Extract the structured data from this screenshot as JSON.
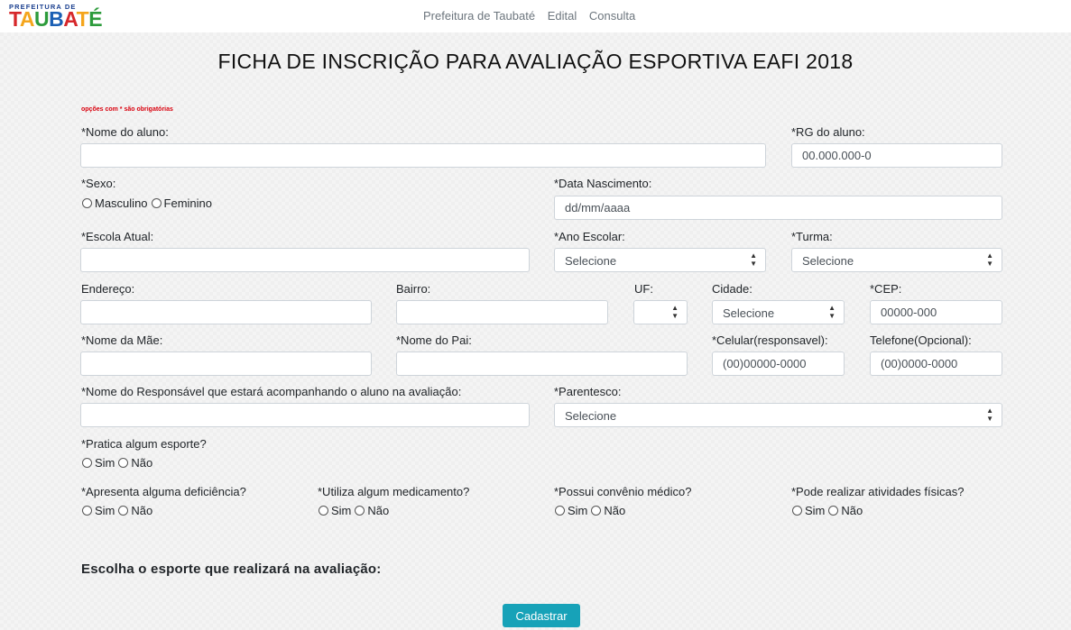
{
  "header": {
    "logo_top": "PREFEITURA DE",
    "logo_letters": [
      "T",
      "A",
      "U",
      "B",
      "A",
      "T",
      "É"
    ],
    "nav": [
      "Prefeitura de Taubaté",
      "Edital",
      "Consulta"
    ]
  },
  "form": {
    "title": "FICHA DE INSCRIÇÃO PARA AVALIAÇÃO ESPORTIVA EAFI 2018",
    "required_note": "opções com * são obrigatórias",
    "nome_aluno": {
      "label": "*Nome do aluno:",
      "placeholder": ""
    },
    "rg_aluno": {
      "label": "*RG do aluno:",
      "placeholder": "00.000.000-0"
    },
    "sexo": {
      "label": "*Sexo:",
      "options": [
        "Masculino",
        "Feminino"
      ]
    },
    "data_nascimento": {
      "label": "*Data Nascimento:",
      "placeholder": "dd/mm/aaaa"
    },
    "escola": {
      "label": "*Escola Atual:",
      "placeholder": ""
    },
    "ano_escolar": {
      "label": "*Ano Escolar:",
      "value": "Selecione"
    },
    "turma": {
      "label": "*Turma:",
      "value": "Selecione"
    },
    "endereco": {
      "label": "Endereço:",
      "placeholder": ""
    },
    "bairro": {
      "label": "Bairro:",
      "placeholder": ""
    },
    "uf": {
      "label": "UF:",
      "value": ""
    },
    "cidade": {
      "label": "Cidade:",
      "value": "Selecione"
    },
    "cep": {
      "label": "*CEP:",
      "placeholder": "00000-000"
    },
    "nome_mae": {
      "label": "*Nome da Mãe:",
      "placeholder": ""
    },
    "nome_pai": {
      "label": "*Nome do Pai:",
      "placeholder": ""
    },
    "celular": {
      "label": "*Celular(responsavel):",
      "placeholder": "(00)00000-0000"
    },
    "telefone": {
      "label": "Telefone(Opcional):",
      "placeholder": "(00)0000-0000"
    },
    "responsavel": {
      "label": "*Nome do Responsável que estará acompanhando o aluno na avaliação:",
      "placeholder": ""
    },
    "parentesco": {
      "label": "*Parentesco:",
      "value": "Selecione"
    },
    "pratica_esporte": {
      "label": "*Pratica algum esporte?",
      "options": [
        "Sim",
        "Não"
      ]
    },
    "deficiencia": {
      "label": "*Apresenta alguma deficiência?",
      "options": [
        "Sim",
        "Não"
      ]
    },
    "medicamento": {
      "label": "*Utiliza algum medicamento?",
      "options": [
        "Sim",
        "Não"
      ]
    },
    "convenio": {
      "label": "*Possui convênio médico?",
      "options": [
        "Sim",
        "Não"
      ]
    },
    "atividades": {
      "label": "*Pode realizar atividades físicas?",
      "options": [
        "Sim",
        "Não"
      ]
    },
    "esporte_section": "Escolha o esporte que realizará na avaliação:",
    "submit_label": "Cadastrar"
  }
}
